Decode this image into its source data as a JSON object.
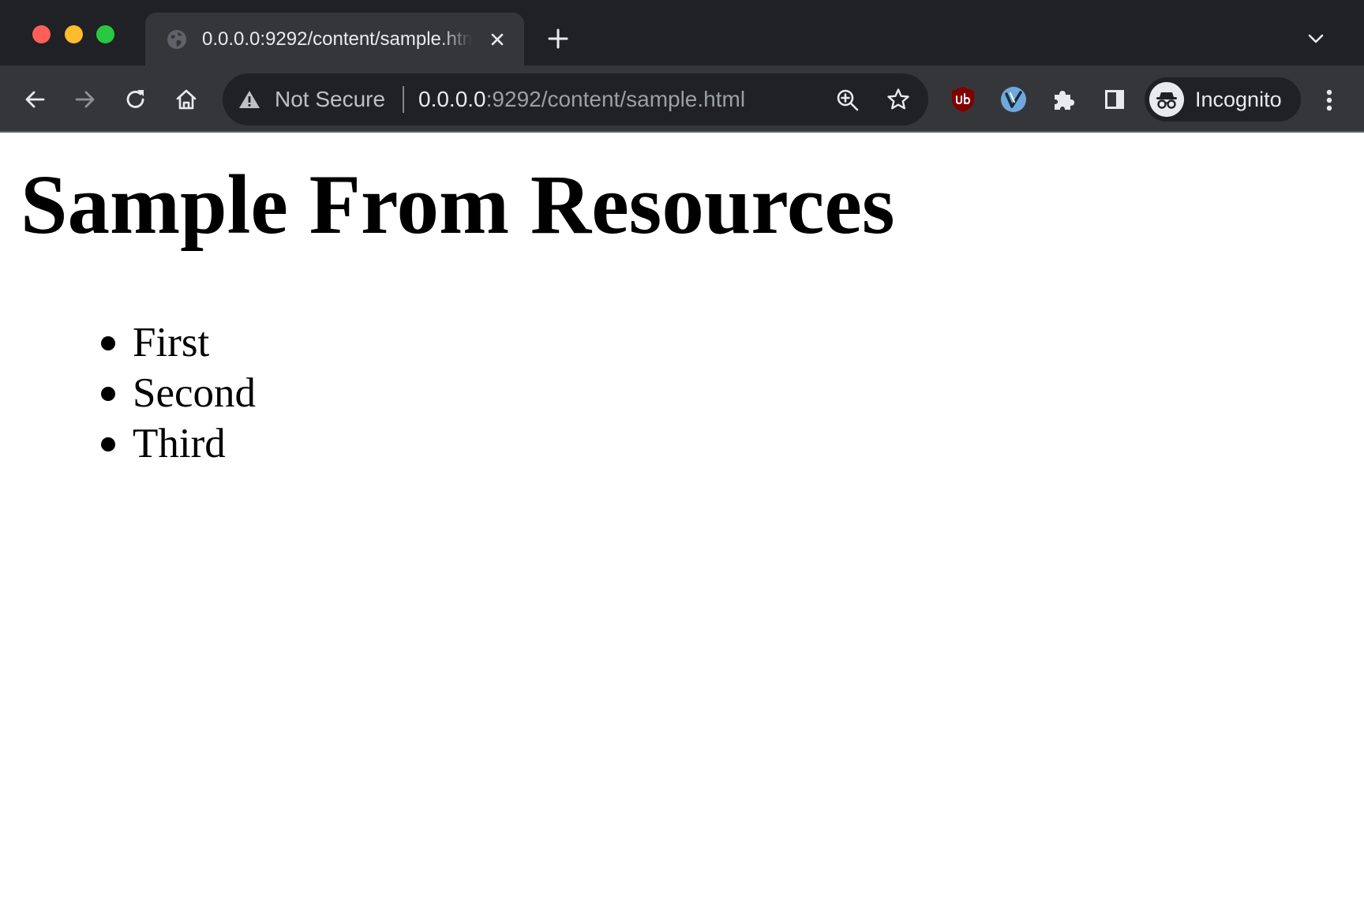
{
  "browser": {
    "tab": {
      "title": "0.0.0.0:9292/content/sample.html"
    },
    "omnibox": {
      "security_label": "Not Secure",
      "url_host": "0.0.0.0",
      "url_rest": ":9292/content/sample.html"
    },
    "profile": {
      "label": "Incognito"
    },
    "icons": {
      "favicon": "globe-icon",
      "tab_close": "close-icon",
      "new_tab": "plus-icon",
      "tab_search": "chevron-down-icon",
      "back": "arrow-left-icon",
      "forward": "arrow-right-icon",
      "reload": "reload-icon",
      "home": "home-icon",
      "security": "warning-triangle-icon",
      "zoom": "zoom-in-icon",
      "bookmark": "star-icon",
      "extension_1": "ublock-origin-icon",
      "extension_2": "vimium-icon",
      "extensions": "puzzle-icon",
      "side_panel": "side-panel-icon",
      "profile_avatar": "incognito-icon",
      "menu": "more-vertical-icon"
    }
  },
  "page": {
    "heading": "Sample From Resources",
    "list_items": [
      "First",
      "Second",
      "Third"
    ]
  }
}
